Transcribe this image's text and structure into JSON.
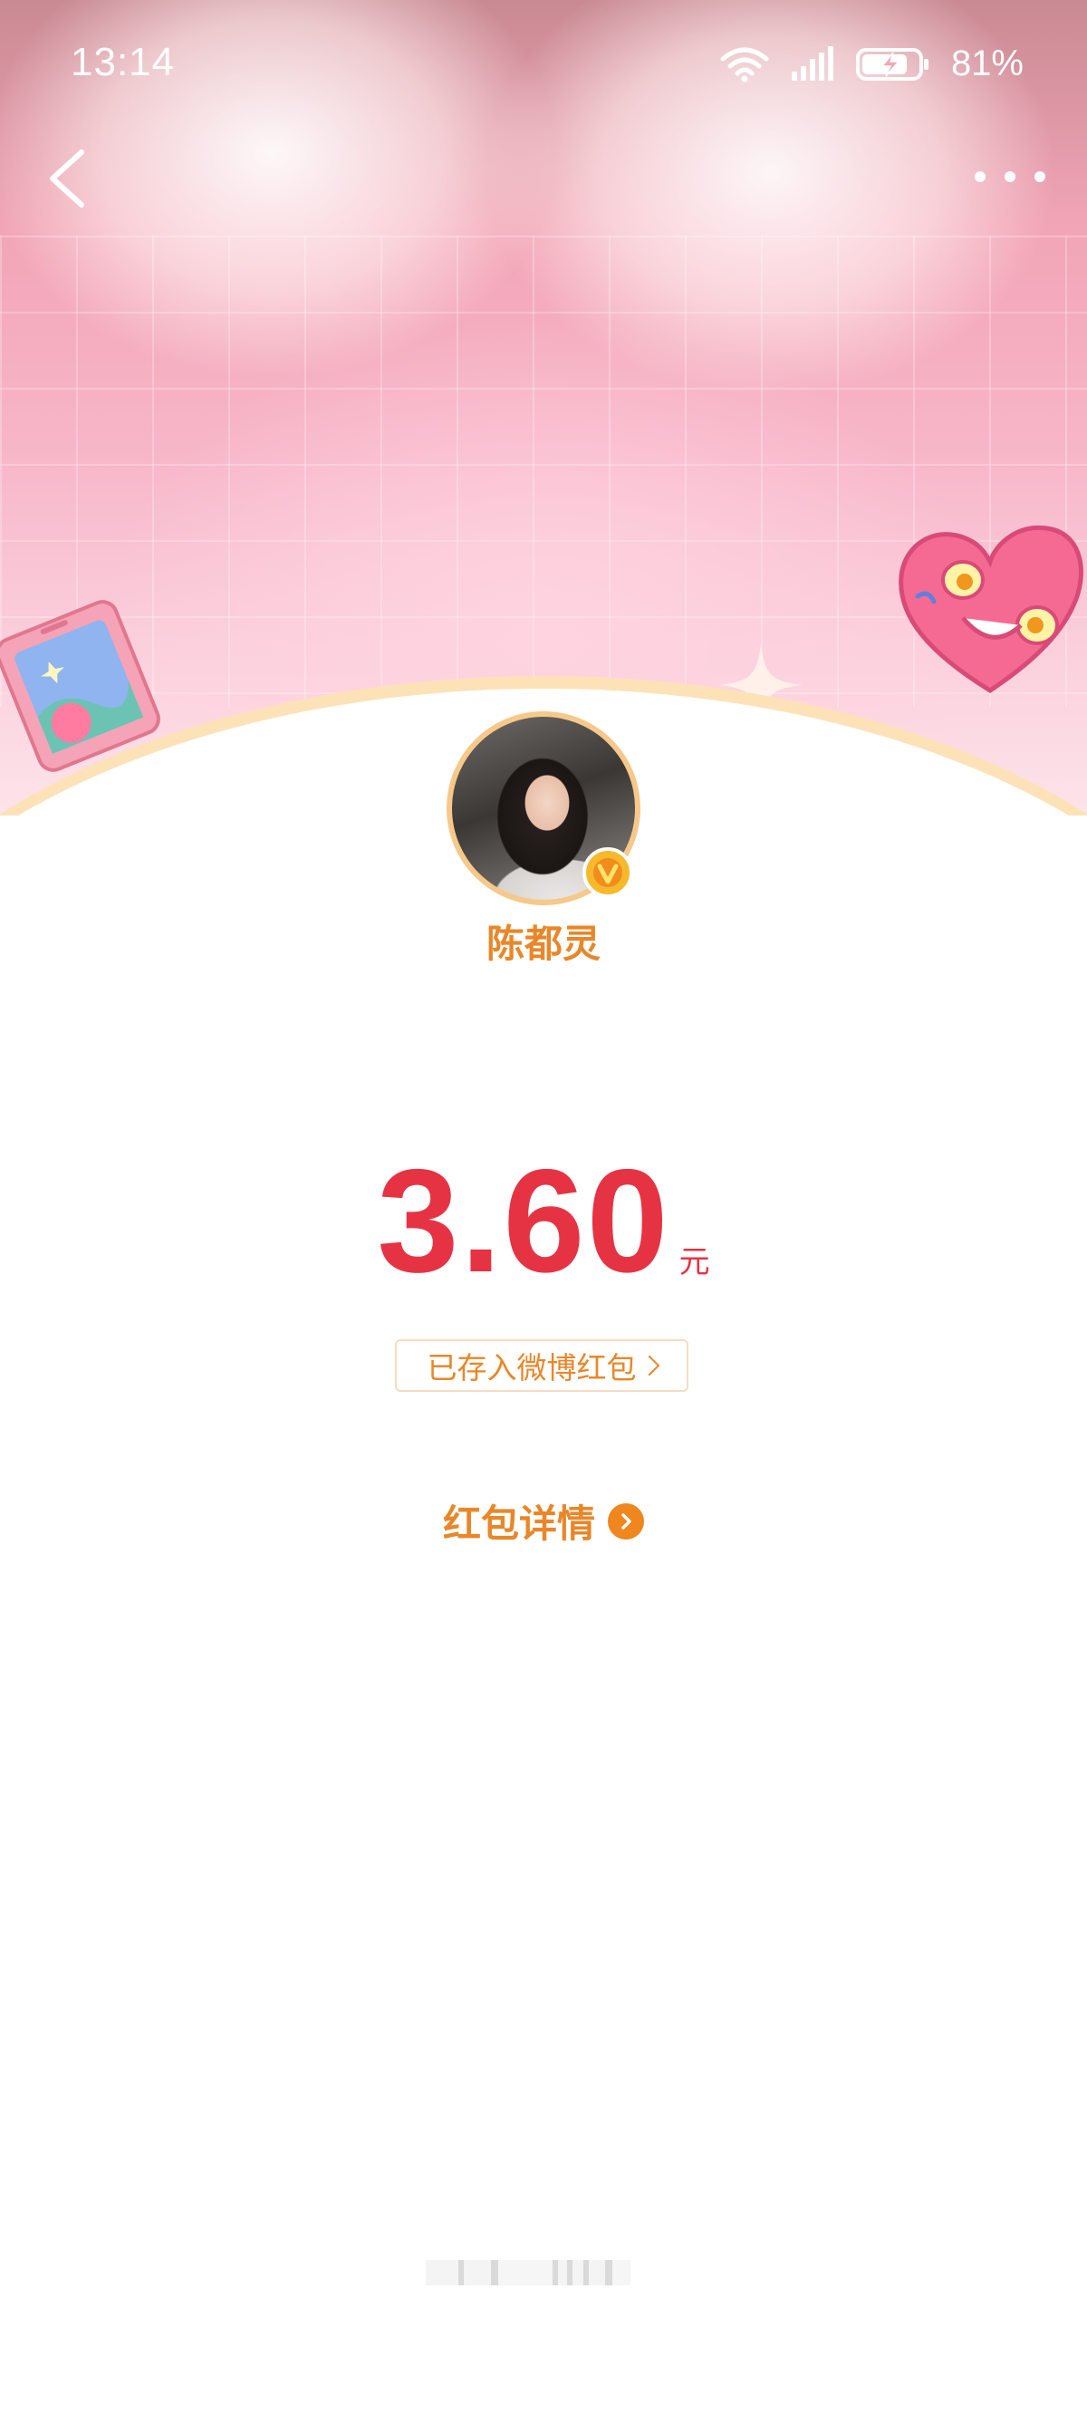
{
  "status_bar": {
    "time": "13:14",
    "battery_percent": "81%",
    "wifi_icon": "wifi-icon",
    "signal_icon": "cellular-signal-icon",
    "battery_icon": "battery-charging-icon",
    "battery_level": 0.81
  },
  "nav": {
    "back_icon": "chevron-left-icon",
    "more_icon": "more-horizontal-icon"
  },
  "sender": {
    "name": "陈都灵",
    "verified_icon": "verified-v-badge-icon"
  },
  "amount": {
    "value": "3.60",
    "unit": "元"
  },
  "deposit": {
    "label": "已存入微博红包"
  },
  "details": {
    "label": "红包详情",
    "icon": "chevron-right-circle-icon"
  },
  "colors": {
    "accent_orange": "#e8872a",
    "amount_red": "#e63343",
    "badge_gold": "#f6b92b"
  }
}
